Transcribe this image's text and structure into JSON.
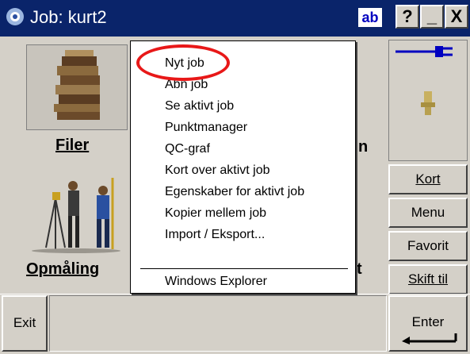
{
  "titlebar": {
    "title": "Job: kurt2",
    "ab_label": "ab",
    "help_label": "?",
    "minimize_label": "_",
    "close_label": "X",
    "background": "#0a246a"
  },
  "tiles": {
    "filer": {
      "label": "Filer"
    },
    "opmaling": {
      "label": "Opmåling"
    },
    "partial_right_label": "n",
    "partial_right_label2": "t"
  },
  "menu": {
    "items": [
      "Nyt job",
      "Åbn job",
      "Se aktivt job",
      "Punktmanager",
      "QC-graf",
      "Kort over aktivt job",
      "Egenskaber for aktivt job",
      "Kopier mellem job",
      "Import / Eksport...",
      "Windows Explorer"
    ],
    "highlight_ring_color": "#e81818"
  },
  "side_buttons": [
    {
      "label": "Kort"
    },
    {
      "label": "Menu"
    },
    {
      "label": "Favorit"
    },
    {
      "label": "Skift til"
    }
  ],
  "bottom": {
    "exit_label": "Exit",
    "enter_label": "Enter"
  },
  "icons": [
    "app-logo-icon",
    "battery-plug-icon",
    "instrument-icon",
    "files-stack-icon",
    "surveyors-icon",
    "enter-arrow-icon"
  ]
}
